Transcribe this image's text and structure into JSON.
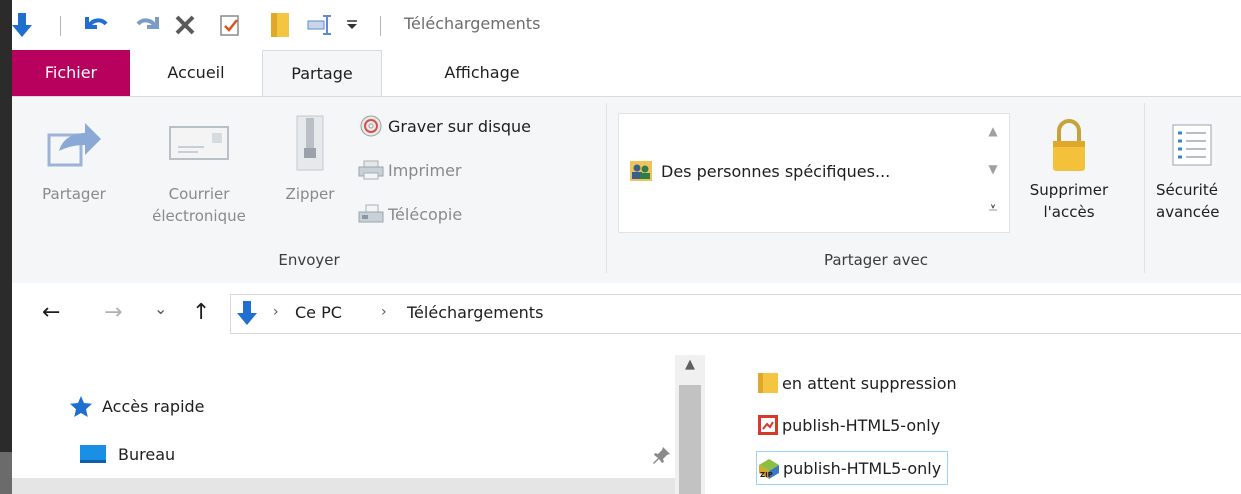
{
  "window": {
    "title": "Téléchargements"
  },
  "quick_access": {
    "icons": [
      "properties-down-arrow-icon",
      "undo-icon",
      "redo-icon",
      "delete-x-icon",
      "checkbox-icon",
      "folder-icon",
      "rename-icon",
      "customize-dropdown-icon"
    ]
  },
  "tabs": [
    {
      "label": "Fichier"
    },
    {
      "label": "Accueil"
    },
    {
      "label": "Partage"
    },
    {
      "label": "Affichage"
    }
  ],
  "ribbon": {
    "send": {
      "group_label": "Envoyer",
      "share_label": "Partager",
      "mail_label_1": "Courrier",
      "mail_label_2": "électronique",
      "zip_label": "Zipper",
      "burn_label": "Graver sur disque",
      "print_label": "Imprimer",
      "fax_label": "Télécopie"
    },
    "share_with": {
      "group_label": "Partager avec",
      "gallery_item": "Des personnes spécifiques...",
      "remove_label_1": "Supprimer",
      "remove_label_2": "l'accès",
      "security_label_1": "Sécurité",
      "security_label_2": "avancée"
    }
  },
  "address": {
    "back": "←",
    "forward": "→",
    "recent": "⌄",
    "up": "↑",
    "crumbs": [
      "Ce PC",
      "Téléchargements"
    ],
    "separator": "›"
  },
  "nav_pane": {
    "items": [
      {
        "label": "Accès rapide",
        "icon": "star-icon"
      },
      {
        "label": "Bureau",
        "icon": "desktop-icon",
        "pin": "pin-icon"
      }
    ]
  },
  "files": [
    {
      "name": "en attent suppression",
      "icon": "folder-icon"
    },
    {
      "name": "publish-HTML5-only",
      "icon": "html-file-icon"
    },
    {
      "name": "publish-HTML5-only",
      "icon": "zip-archive-icon"
    }
  ],
  "colors": {
    "file_tab": "#b8005d",
    "accent_blue": "#1f6fd1",
    "folder": "#f5c542",
    "selection_border": "#99d1ff"
  }
}
